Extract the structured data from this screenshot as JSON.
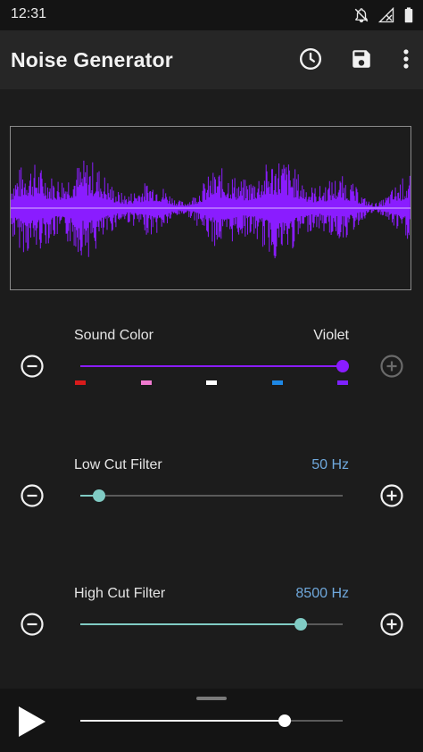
{
  "status_bar": {
    "time": "12:31",
    "icons": [
      "notifications-off-icon",
      "no-signal-icon",
      "battery-icon"
    ]
  },
  "app_bar": {
    "title": "Noise Generator",
    "actions": [
      "timer-clock-icon",
      "save-icon",
      "more-vert-icon"
    ]
  },
  "waveform": {
    "color": "#8a1cff",
    "baseline_color": "#d8b4ff"
  },
  "controls": {
    "sound_color": {
      "label": "Sound Color",
      "value": "Violet",
      "level_fraction": 1.0,
      "accent": "#8a1cff",
      "value_color": "#e8e8e8",
      "markers": [
        {
          "name": "red",
          "color": "#d81b1b"
        },
        {
          "name": "pink",
          "color": "#f07ad0"
        },
        {
          "name": "white",
          "color": "#ffffff"
        },
        {
          "name": "blue",
          "color": "#1e88e5"
        },
        {
          "name": "violet",
          "color": "#7e22ff"
        }
      ]
    },
    "low_cut": {
      "label": "Low Cut Filter",
      "value": "50 Hz",
      "level_fraction": 0.07,
      "accent": "#80cbc4",
      "value_color": "#6fa8dc"
    },
    "high_cut": {
      "label": "High Cut Filter",
      "value": "8500 Hz",
      "level_fraction": 0.84,
      "accent": "#80cbc4",
      "value_color": "#6fa8dc"
    }
  },
  "player": {
    "play_icon": "play-icon",
    "volume_fraction": 0.78
  }
}
